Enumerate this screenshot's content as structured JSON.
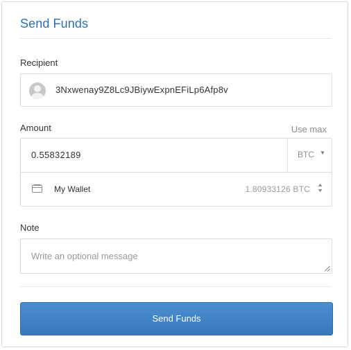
{
  "header": {
    "title": "Send Funds"
  },
  "recipient": {
    "label": "Recipient",
    "address": "3Nxwenay9Z8Lc9JBiywExpnEFiLp6Afp8v",
    "avatar_icon": "user-avatar-icon"
  },
  "amount": {
    "label": "Amount",
    "use_max": "Use max",
    "value": "0.55832189",
    "currency": "BTC",
    "currency_icon": "caret-down-icon"
  },
  "wallet": {
    "icon": "wallet-icon",
    "name": "My Wallet",
    "balance": "1.80933126 BTC",
    "selector_icon": "up-down-caret-icon"
  },
  "note": {
    "label": "Note",
    "placeholder": "Write an optional message",
    "value": ""
  },
  "actions": {
    "send_label": "Send Funds"
  },
  "colors": {
    "accent": "#2b71b1",
    "button": "#3f82c6",
    "border": "#dcdcdc",
    "muted_text": "#8c8c8c"
  }
}
